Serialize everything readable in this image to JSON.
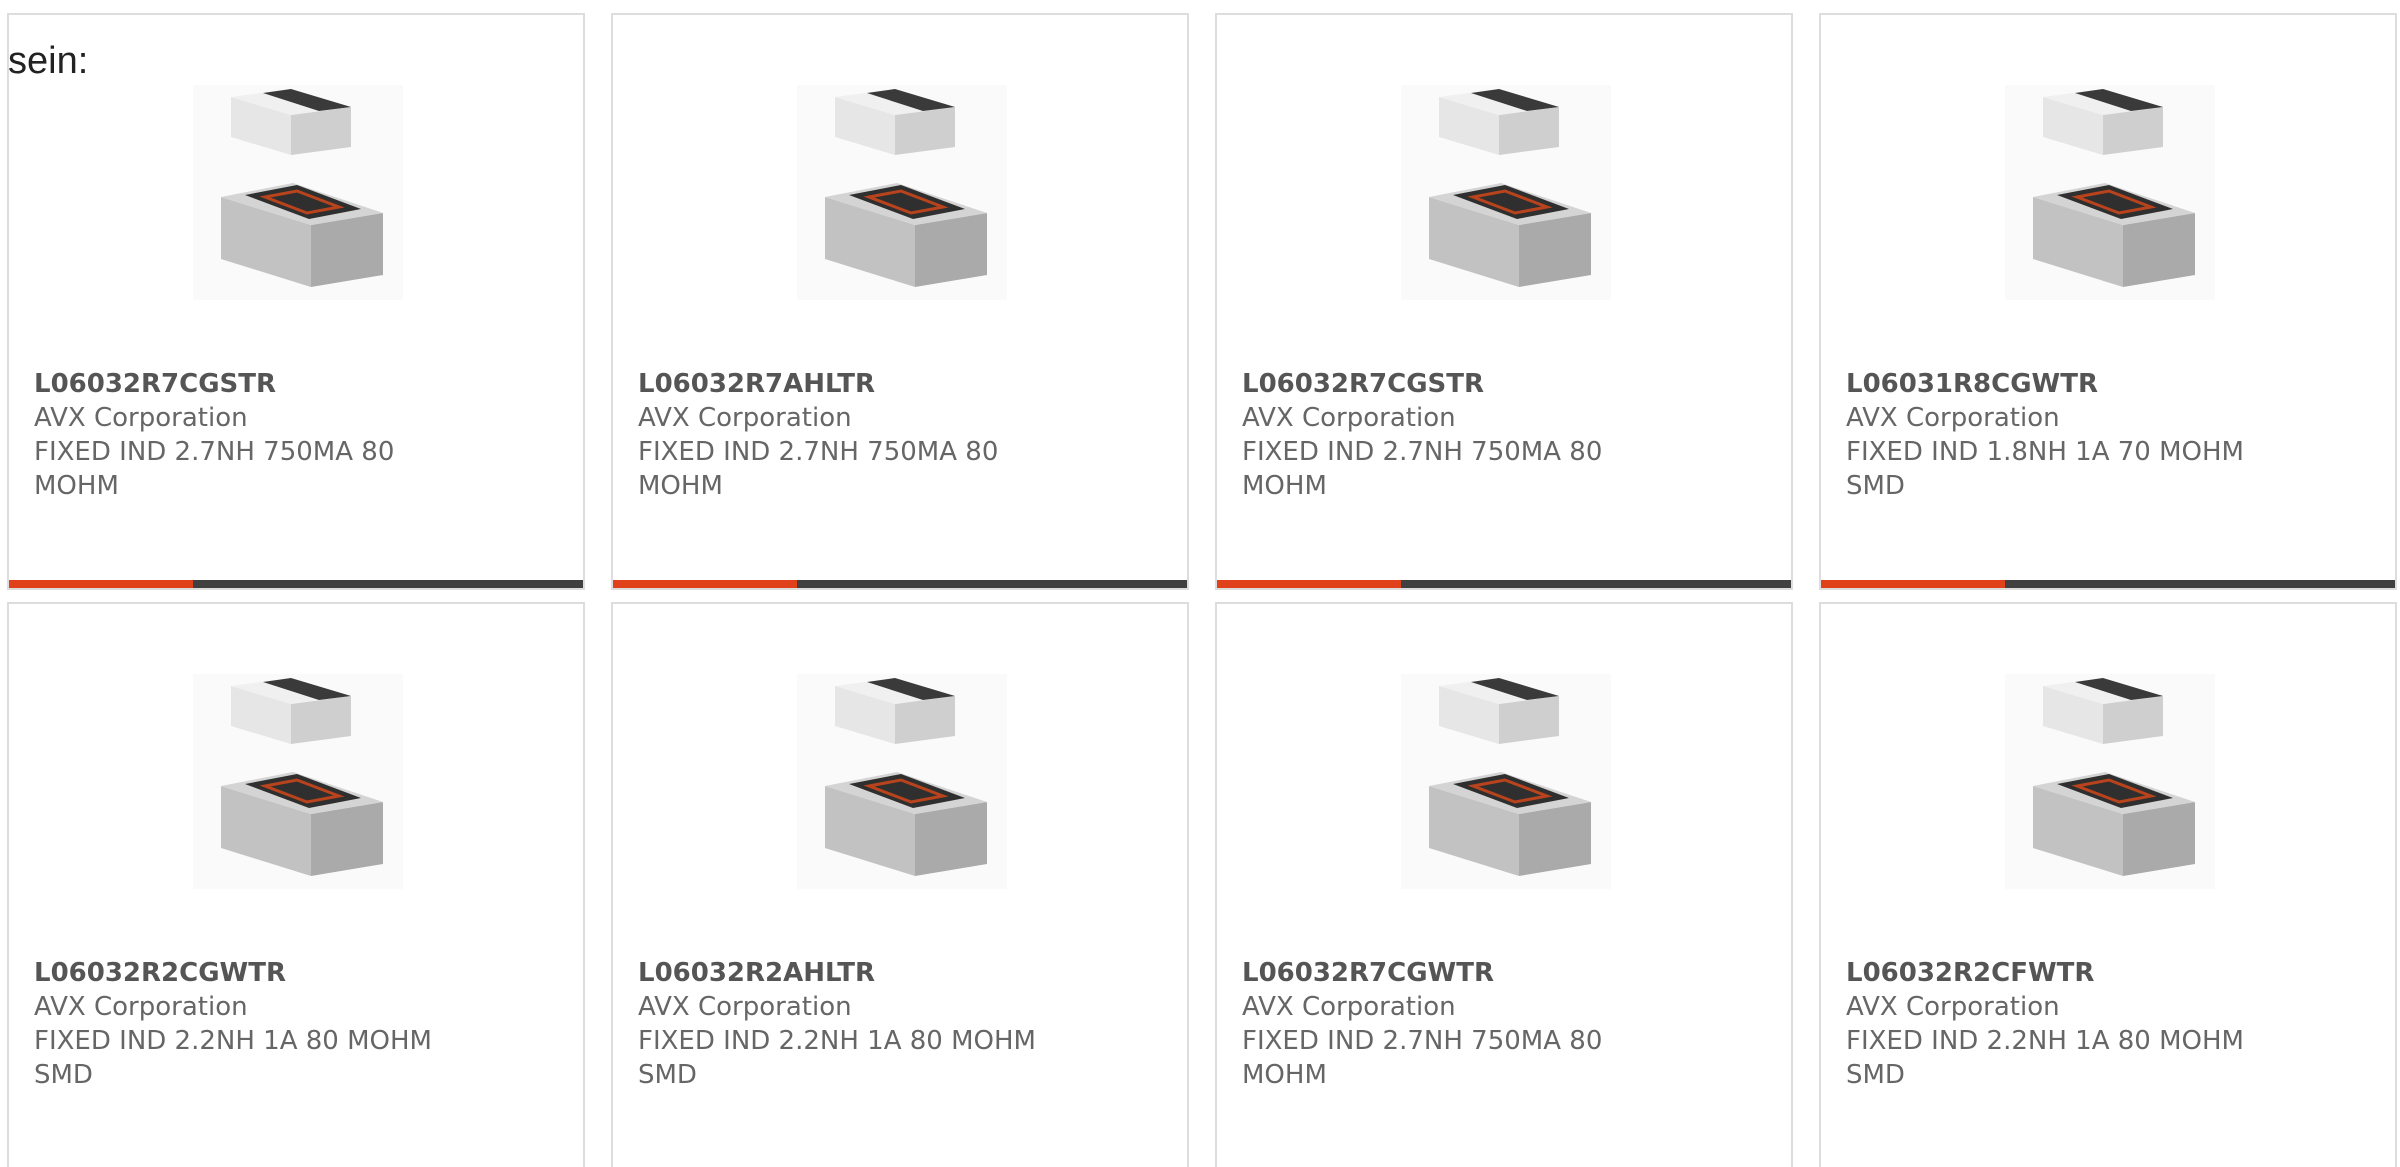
{
  "intro_text": "sein:",
  "products": [
    {
      "part": "L06032R7CGSTR",
      "maker": "AVX Corporation",
      "desc_1": "FIXED IND 2.7NH 750MA 80",
      "desc_2": "MOHM",
      "progress": 0.32
    },
    {
      "part": "L06032R7AHLTR",
      "maker": "AVX Corporation",
      "desc_1": "FIXED IND 2.7NH 750MA 80",
      "desc_2": "MOHM",
      "progress": 0.32
    },
    {
      "part": "L06032R7CGSTR",
      "maker": "AVX Corporation",
      "desc_1": "FIXED IND 2.7NH 750MA 80",
      "desc_2": "MOHM",
      "progress": 0.32
    },
    {
      "part": "L06031R8CGWTR",
      "maker": "AVX Corporation",
      "desc_1": "FIXED IND 1.8NH 1A 70 MOHM",
      "desc_2": "SMD",
      "progress": 0.32
    },
    {
      "part": "L06032R2CGWTR",
      "maker": "AVX Corporation",
      "desc_1": "FIXED IND 2.2NH 1A 80 MOHM",
      "desc_2": "SMD",
      "progress": 0.32
    },
    {
      "part": "L06032R2AHLTR",
      "maker": "AVX Corporation",
      "desc_1": "FIXED IND 2.2NH 1A 80 MOHM",
      "desc_2": "SMD",
      "progress": 0.32
    },
    {
      "part": "L06032R7CGWTR",
      "maker": "AVX Corporation",
      "desc_1": "FIXED IND 2.7NH 750MA 80",
      "desc_2": "MOHM",
      "progress": 0.32
    },
    {
      "part": "L06032R2CFWTR",
      "maker": "AVX Corporation",
      "desc_1": "FIXED IND 2.2NH 1A 80 MOHM",
      "desc_2": "SMD",
      "progress": 0.32
    }
  ],
  "colors": {
    "accent": "#e0401a",
    "bar_track": "#404040",
    "text": "#666666",
    "border": "#dddddd"
  },
  "icons": {
    "product_image": "smd-inductor-chip-icon"
  }
}
